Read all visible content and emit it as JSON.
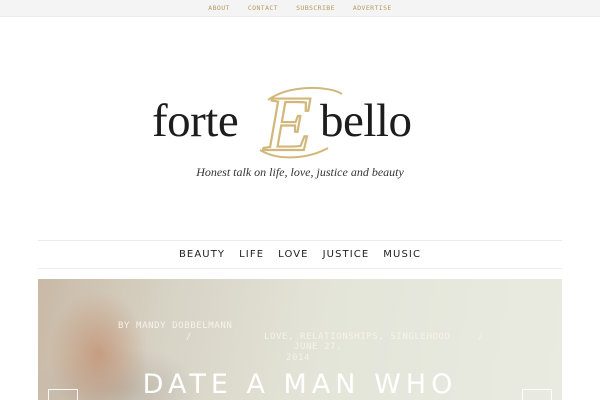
{
  "top_nav": {
    "items": [
      "ABOUT",
      "CONTACT",
      "SUBSCRIBE",
      "ADVERTISE"
    ]
  },
  "logo": {
    "word_left": "forte",
    "word_right": "bello",
    "monogram": "E",
    "accent_color": "#d2b77a"
  },
  "tagline": "Honest talk on life, love, justice and beauty",
  "main_nav": {
    "items": [
      "BEAUTY",
      "LIFE",
      "LOVE",
      "JUSTICE",
      "MUSIC"
    ]
  },
  "featured_post": {
    "byline": "BY MANDY DOBBELMANN",
    "separator": "/",
    "categories": "LOVE, RELATIONSHIPS, SINGLEHOOD",
    "date_line1": "JUNE 27,",
    "date_line2": "2014",
    "headline": "DATE A MAN WHO"
  },
  "icons": {
    "prev": "arrow-left-icon",
    "next": "arrow-right-icon"
  }
}
